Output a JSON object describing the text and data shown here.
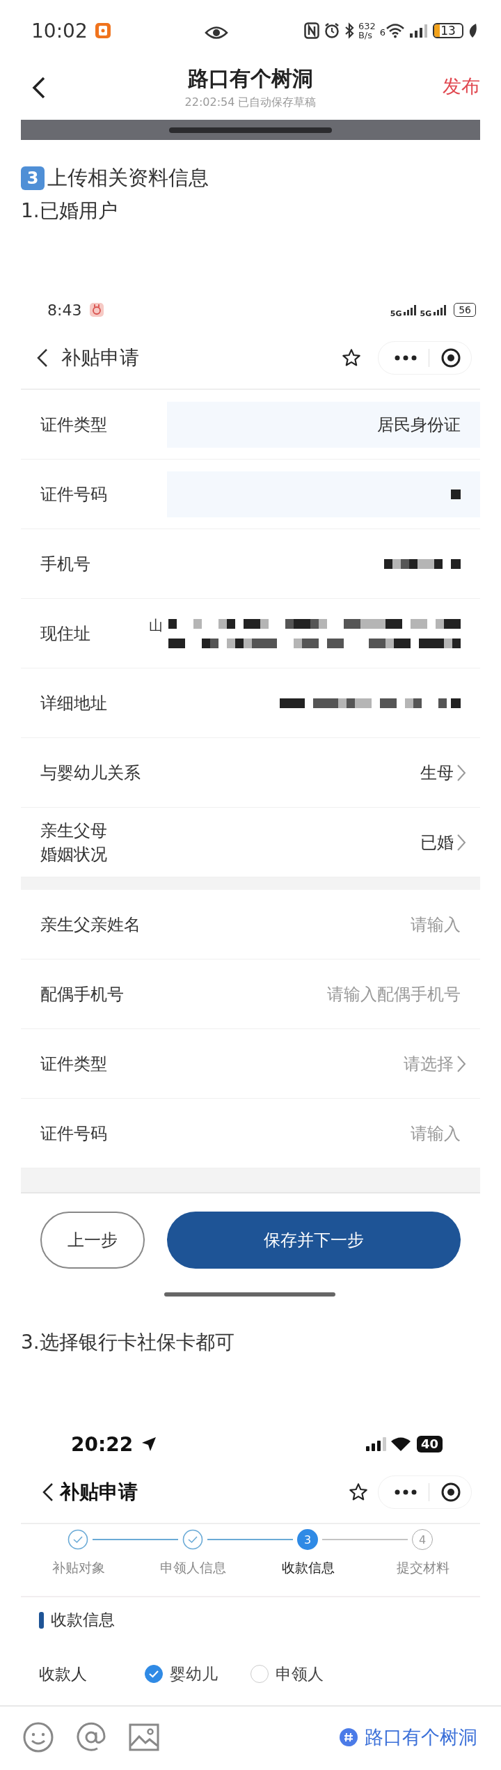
{
  "status_bar": {
    "time": "10:02",
    "speed_value": "632",
    "speed_unit": "B/s",
    "wifi_label": "6",
    "battery": "13"
  },
  "header": {
    "title": "路口有个树洞",
    "subtitle": "22:02:54 已自动保存草稿",
    "action": "发布"
  },
  "heading": {
    "badge": "3",
    "text": "上传相关资料信息"
  },
  "caption_1": "1.已婚用户",
  "screenshot_1": {
    "status_bar": {
      "time": "8:43",
      "network_1": "5G",
      "network_2": "5G",
      "battery": "56"
    },
    "title": "补贴申请",
    "sections": [
      [
        {
          "label": "证件类型",
          "kind": "text",
          "value": "居民身份证",
          "shaded": true
        },
        {
          "label": "证件号码",
          "kind": "masked",
          "shaded": true
        },
        {
          "label": "手机号",
          "kind": "masked",
          "shaded": false
        },
        {
          "label": "现住址",
          "kind": "masked",
          "value": "山",
          "shaded": false
        },
        {
          "label": "详细地址",
          "kind": "masked",
          "shaded": false
        },
        {
          "label": "与婴幼儿关系",
          "kind": "select",
          "value": "生母"
        },
        {
          "label": "亲生父母",
          "label_2": "婚姻状况",
          "kind": "select",
          "value": "已婚"
        }
      ],
      [
        {
          "label": "亲生父亲姓名",
          "kind": "input",
          "placeholder": "请输入"
        },
        {
          "label": "配偶手机号",
          "kind": "input",
          "placeholder": "请输入配偶手机号"
        },
        {
          "label": "证件类型",
          "kind": "select",
          "placeholder": "请选择"
        },
        {
          "label": "证件号码",
          "kind": "input",
          "placeholder": "请输入"
        }
      ]
    ],
    "buttons": [
      {
        "label": "上一步",
        "kind": "secondary"
      },
      {
        "label": "保存并下一步",
        "kind": "primary"
      }
    ]
  },
  "caption_3": "3.选择银行卡社保卡都可",
  "screenshot_2": {
    "status_bar": {
      "time": "20:22",
      "battery": "40"
    },
    "title": "补贴申请",
    "steps": [
      {
        "label": "补贴对象",
        "done": true,
        "current": false
      },
      {
        "label": "申领人信息",
        "done": true,
        "current": false
      },
      {
        "label": "收款信息",
        "number": "3",
        "done": false,
        "current": true
      },
      {
        "label": "提交材料",
        "number": "4",
        "done": false,
        "current": false
      }
    ],
    "section_title": "收款信息",
    "payee": {
      "label": "收款人",
      "options": [
        {
          "label": "婴幼儿",
          "selected": true
        },
        {
          "label": "申领人",
          "selected": false
        }
      ]
    }
  },
  "toolbar": {
    "topic": "路口有个树洞"
  }
}
